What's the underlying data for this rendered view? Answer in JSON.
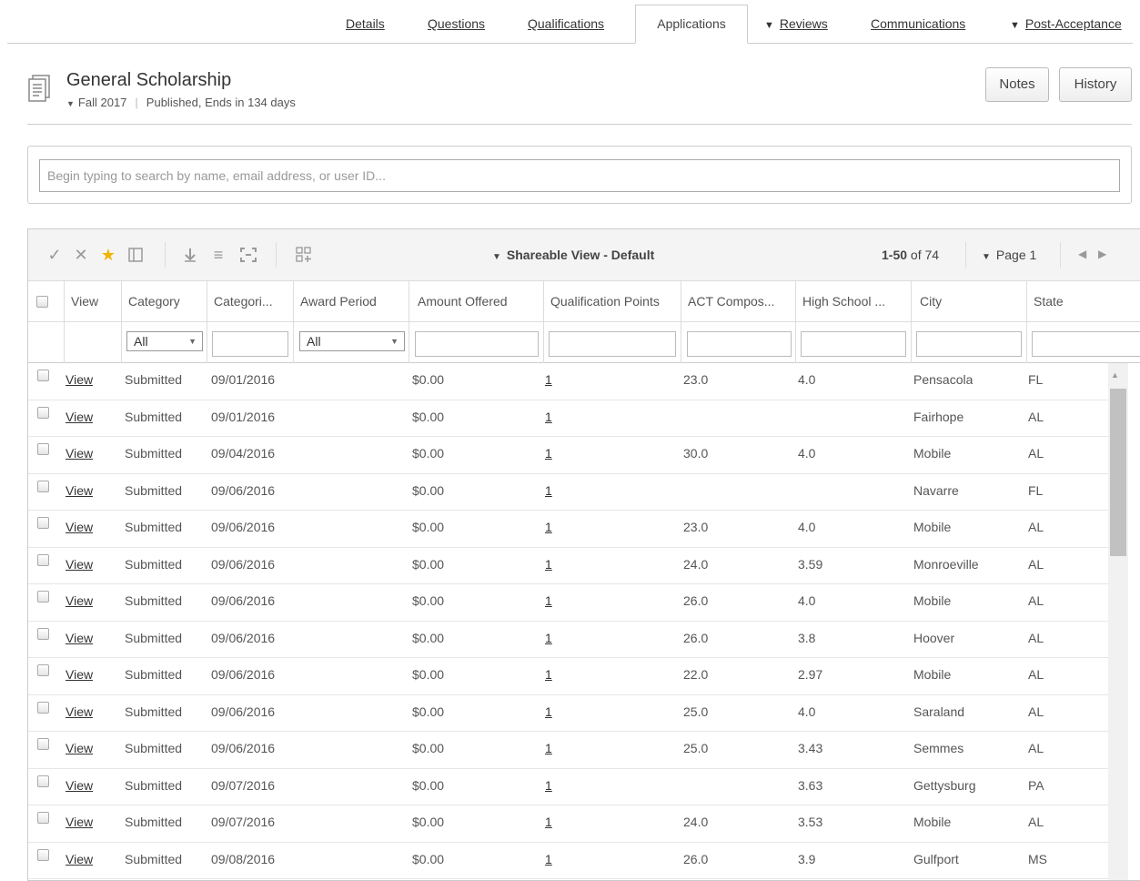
{
  "tabs": [
    {
      "label": "Details",
      "caret": false
    },
    {
      "label": "Questions",
      "caret": false
    },
    {
      "label": "Qualifications",
      "caret": false
    },
    {
      "label": "Applications",
      "caret": false
    },
    {
      "label": "Reviews",
      "caret": true
    },
    {
      "label": "Communications",
      "caret": false
    },
    {
      "label": "Post-Acceptance",
      "caret": true
    }
  ],
  "header": {
    "title": "General Scholarship",
    "term": "Fall 2017",
    "status": "Published, Ends in 134 days",
    "notes_label": "Notes",
    "history_label": "History"
  },
  "search": {
    "placeholder": "Begin typing to search by name, email address, or user ID...",
    "value": ""
  },
  "toolbar": {
    "view_name": "Shareable View - Default",
    "range": "1-50",
    "of_total": "of 74",
    "page_label": "Page 1",
    "icons": [
      "approve-check-icon",
      "reject-x-icon",
      "favorite-star-icon",
      "columns-panel-icon",
      "download-icon",
      "list-icon",
      "expand-icon",
      "add-widget-icon"
    ]
  },
  "columns": [
    "View",
    "Category",
    "Categori...",
    "Award Period",
    "Amount Offered",
    "Qualification Points",
    "ACT Compos...",
    "High School ...",
    "City",
    "State"
  ],
  "filters": {
    "category": "All",
    "award_period": "All"
  },
  "rows": [
    {
      "view": "View",
      "category": "Submitted",
      "date": "09/01/2016",
      "award_period": "",
      "amount": "$0.00",
      "points": "1",
      "act": "23.0",
      "gpa": "4.0",
      "city": "Pensacola",
      "state": "FL"
    },
    {
      "view": "View",
      "category": "Submitted",
      "date": "09/01/2016",
      "award_period": "",
      "amount": "$0.00",
      "points": "1",
      "act": "",
      "gpa": "",
      "city": "Fairhope",
      "state": "AL"
    },
    {
      "view": "View",
      "category": "Submitted",
      "date": "09/04/2016",
      "award_period": "",
      "amount": "$0.00",
      "points": "1",
      "act": "30.0",
      "gpa": "4.0",
      "city": "Mobile",
      "state": "AL"
    },
    {
      "view": "View",
      "category": "Submitted",
      "date": "09/06/2016",
      "award_period": "",
      "amount": "$0.00",
      "points": "1",
      "act": "",
      "gpa": "",
      "city": "Navarre",
      "state": "FL"
    },
    {
      "view": "View",
      "category": "Submitted",
      "date": "09/06/2016",
      "award_period": "",
      "amount": "$0.00",
      "points": "1",
      "act": "23.0",
      "gpa": "4.0",
      "city": "Mobile",
      "state": "AL"
    },
    {
      "view": "View",
      "category": "Submitted",
      "date": "09/06/2016",
      "award_period": "",
      "amount": "$0.00",
      "points": "1",
      "act": "24.0",
      "gpa": "3.59",
      "city": "Monroeville",
      "state": "AL"
    },
    {
      "view": "View",
      "category": "Submitted",
      "date": "09/06/2016",
      "award_period": "",
      "amount": "$0.00",
      "points": "1",
      "act": "26.0",
      "gpa": "4.0",
      "city": "Mobile",
      "state": "AL"
    },
    {
      "view": "View",
      "category": "Submitted",
      "date": "09/06/2016",
      "award_period": "",
      "amount": "$0.00",
      "points": "1",
      "act": "26.0",
      "gpa": "3.8",
      "city": "Hoover",
      "state": "AL"
    },
    {
      "view": "View",
      "category": "Submitted",
      "date": "09/06/2016",
      "award_period": "",
      "amount": "$0.00",
      "points": "1",
      "act": "22.0",
      "gpa": "2.97",
      "city": "Mobile",
      "state": "AL"
    },
    {
      "view": "View",
      "category": "Submitted",
      "date": "09/06/2016",
      "award_period": "",
      "amount": "$0.00",
      "points": "1",
      "act": "25.0",
      "gpa": "4.0",
      "city": "Saraland",
      "state": "AL"
    },
    {
      "view": "View",
      "category": "Submitted",
      "date": "09/06/2016",
      "award_period": "",
      "amount": "$0.00",
      "points": "1",
      "act": "25.0",
      "gpa": "3.43",
      "city": "Semmes",
      "state": "AL"
    },
    {
      "view": "View",
      "category": "Submitted",
      "date": "09/07/2016",
      "award_period": "",
      "amount": "$0.00",
      "points": "1",
      "act": "",
      "gpa": "3.63",
      "city": "Gettysburg",
      "state": "PA"
    },
    {
      "view": "View",
      "category": "Submitted",
      "date": "09/07/2016",
      "award_period": "",
      "amount": "$0.00",
      "points": "1",
      "act": "24.0",
      "gpa": "3.53",
      "city": "Mobile",
      "state": "AL"
    },
    {
      "view": "View",
      "category": "Submitted",
      "date": "09/08/2016",
      "award_period": "",
      "amount": "$0.00",
      "points": "1",
      "act": "26.0",
      "gpa": "3.9",
      "city": "Gulfport",
      "state": "MS"
    }
  ],
  "colors": {
    "border": "#cccccc",
    "toolbar_bg": "#f4f4f4",
    "star": "#f0b400",
    "text": "#333333"
  }
}
